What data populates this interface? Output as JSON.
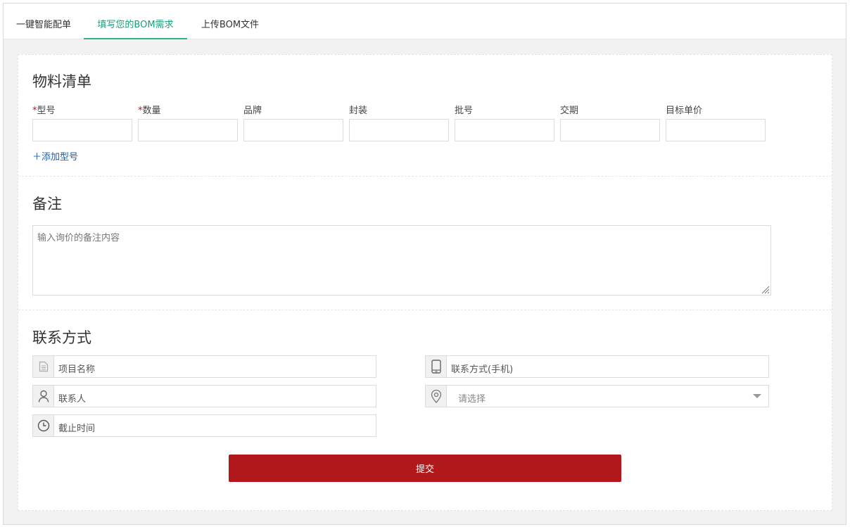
{
  "tabs": [
    {
      "label": "一键智能配单",
      "active": false
    },
    {
      "label": "填写您的BOM需求",
      "active": true
    },
    {
      "label": "上传BOM文件",
      "active": false
    }
  ],
  "bom": {
    "title": "物料清单",
    "columns": [
      {
        "label": "型号",
        "required": true
      },
      {
        "label": "数量",
        "required": true
      },
      {
        "label": "品牌",
        "required": false
      },
      {
        "label": "封装",
        "required": false
      },
      {
        "label": "批号",
        "required": false
      },
      {
        "label": "交期",
        "required": false
      },
      {
        "label": "目标单价",
        "required": false
      }
    ],
    "required_mark": "*",
    "add_link": "＋添加型号"
  },
  "remark": {
    "title": "备注",
    "placeholder": "输入询价的备注内容"
  },
  "contact": {
    "title": "联系方式",
    "project_name": "项目名称",
    "contact_person": "联系人",
    "deadline": "截止时间",
    "phone": "联系方式(手机)",
    "region_select": "请选择"
  },
  "submit_label": "提交",
  "colors": {
    "accent_green": "#2cb482",
    "submit_red": "#b0181c",
    "link_blue": "#1e5fa8"
  }
}
